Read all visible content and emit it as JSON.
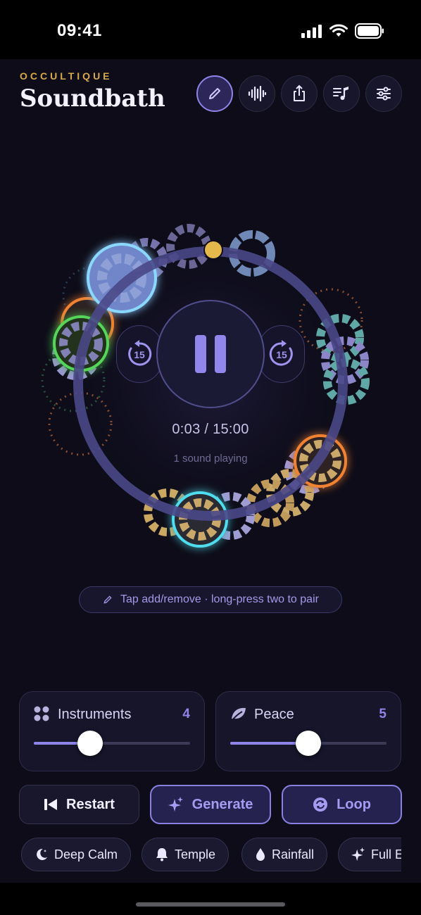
{
  "status_bar": {
    "time": "09:41"
  },
  "header": {
    "brand": "OCCULTIQUE",
    "title": "Soundbath",
    "toolbar": [
      {
        "icon": "pencil-icon",
        "active": true
      },
      {
        "icon": "waveform-icon",
        "active": false
      },
      {
        "icon": "share-icon",
        "active": false
      },
      {
        "icon": "playlist-icon",
        "active": false
      },
      {
        "icon": "sliders-icon",
        "active": false
      }
    ]
  },
  "player": {
    "skip_back_label": "15",
    "skip_forward_label": "15",
    "progress": "0:03 / 15:00",
    "playing_status": "1 sound playing",
    "progress_fraction": 0.0033
  },
  "hint": {
    "text": "Tap add/remove · long-press two to pair"
  },
  "instruments": {
    "label": "Instruments",
    "value": "4",
    "fraction": 0.36
  },
  "peace": {
    "label": "Peace",
    "value": "5",
    "fraction": 0.5
  },
  "actions": {
    "restart_label": "Restart",
    "generate_label": "Generate",
    "loop_label": "Loop"
  },
  "presets": [
    {
      "label": "Deep Calm",
      "icon": "moon-stars-icon"
    },
    {
      "label": "Temple",
      "icon": "bell-icon"
    },
    {
      "label": "Rainfall",
      "icon": "drop-icon"
    },
    {
      "label": "Full E",
      "icon": "sparkles-icon"
    }
  ],
  "colors": {
    "accent": "#8f84e8",
    "gold": "#e5b84c",
    "background": "#0d0c18",
    "green": "#55d65a",
    "orange": "#f08232",
    "cyan": "#4fdcee",
    "teal": "#5fa8a6"
  }
}
